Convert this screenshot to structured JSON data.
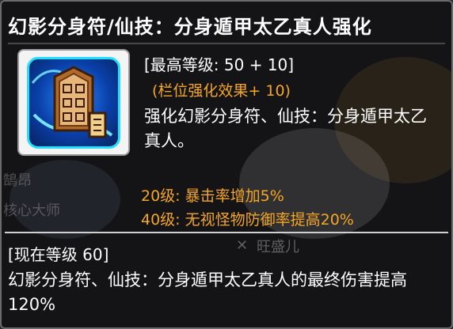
{
  "tooltip": {
    "title": "幻影分身符/仙技：分身遁甲太乙真人强化",
    "icon_name": "talisman-skill-icon",
    "max_level": "[最高等级: 50 + 10]",
    "bonus": "(栏位强化效果+ 10)",
    "description": "强化幻影分身符、仙技：分身遁甲太乙真人。",
    "milestones": [
      "20级: 暴击率增加5%",
      "40级: 无视怪物防御率提高20%"
    ],
    "current_level": "[现在等级 60]",
    "current_effect": "幻影分身符、仙技：分身遁甲太乙真人的最终伤害提高120%",
    "colors": {
      "highlight": "#f5a623",
      "text": "#ffffff",
      "icon_border": "#1fe0ff"
    }
  },
  "background": {
    "ghost_text_1": "鵠昂",
    "ghost_text_2": "核心大师",
    "ghost_text_3": "旺盛儿"
  }
}
